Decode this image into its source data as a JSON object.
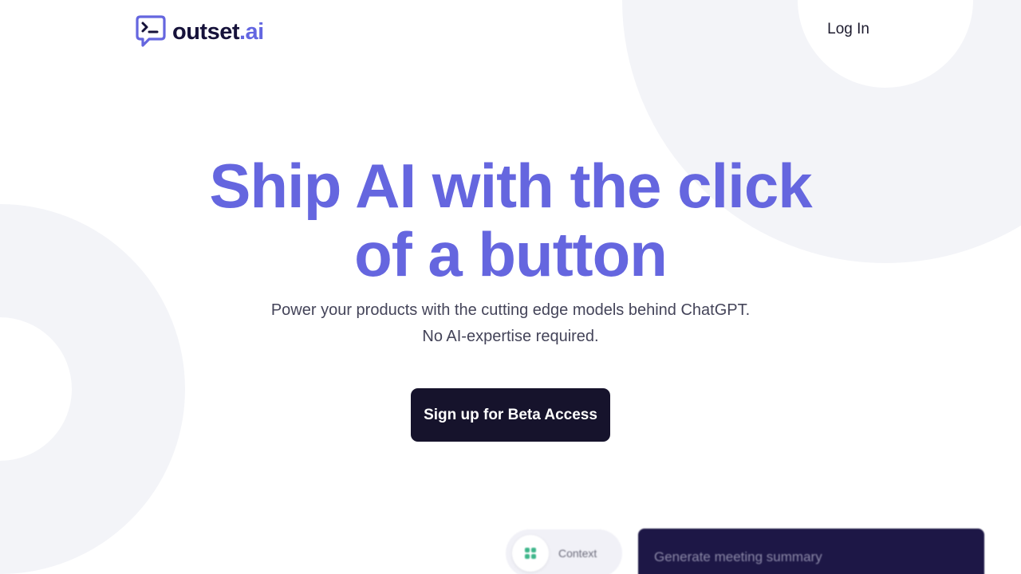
{
  "brand": {
    "name": "outset",
    "tld": ".ai"
  },
  "nav": {
    "login_label": "Log In"
  },
  "hero": {
    "title_line1": "Ship AI with the click",
    "title_line2": "of a button",
    "subtitle_line1": "Power your products with the cutting edge models behind ChatGPT.",
    "subtitle_line2": "No AI-expertise required."
  },
  "cta": {
    "label": "Sign up for Beta Access"
  },
  "preview": {
    "context_label": "Context",
    "summary_prompt": "Generate meeting summary"
  },
  "colors": {
    "accent": "#6566df",
    "dark": "#16132c",
    "ring": "#f3f4f8",
    "icon_green": "#3fb68b"
  },
  "icons": {
    "brand": "terminal-chat-bubble-icon",
    "context": "grid-dots-icon"
  }
}
